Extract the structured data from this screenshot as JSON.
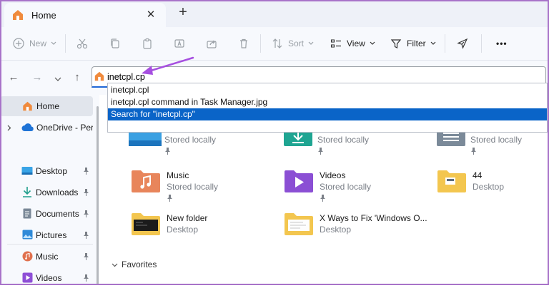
{
  "window": {
    "tab_title": "Home",
    "new_tab_symbol": "+",
    "close_symbol": "✕"
  },
  "toolbar": {
    "new_label": "New",
    "sort_label": "Sort",
    "view_label": "View",
    "filter_label": "Filter",
    "more_label": "•••"
  },
  "address_bar": {
    "value": "inetcpl.cp",
    "suggestions": [
      "inetcpl.cpl",
      "inetcpl.cpl command in Task Manager.jpg",
      "Search for \"inetcpl.cp\""
    ],
    "selected_index": 2
  },
  "sidebar": {
    "items": [
      {
        "label": "Home",
        "icon": "home-icon",
        "selected": true
      },
      {
        "label": "OneDrive - Perso",
        "icon": "cloud-icon"
      },
      {
        "label": "Desktop",
        "icon": "desktop-icon",
        "pinned": true
      },
      {
        "label": "Downloads",
        "icon": "download-icon",
        "pinned": true
      },
      {
        "label": "Documents",
        "icon": "document-icon",
        "pinned": true
      },
      {
        "label": "Pictures",
        "icon": "pictures-icon",
        "pinned": true
      },
      {
        "label": "Music",
        "icon": "music-icon",
        "pinned": true
      },
      {
        "label": "Videos",
        "icon": "videos-icon",
        "pinned": true
      }
    ]
  },
  "quick_access": {
    "items": [
      {
        "name": "",
        "sub": "Stored locally",
        "pinned": true,
        "icon": "desktop-folder-icon"
      },
      {
        "name": "",
        "sub": "Stored locally",
        "pinned": true,
        "icon": "downloads-folder-icon"
      },
      {
        "name": "",
        "sub": "Stored locally",
        "pinned": true,
        "icon": "documents-folder-icon"
      },
      {
        "name": "Music",
        "sub": "Stored locally",
        "pinned": true,
        "icon": "music-folder-icon"
      },
      {
        "name": "Videos",
        "sub": "Stored locally",
        "pinned": true,
        "icon": "videos-folder-icon"
      },
      {
        "name": "44",
        "sub": "Desktop",
        "pinned": false,
        "icon": "folder-icon"
      },
      {
        "name": "New folder",
        "sub": "Desktop",
        "pinned": false,
        "icon": "folder-icon"
      },
      {
        "name": "X Ways to Fix 'Windows O...",
        "sub": "Desktop",
        "pinned": false,
        "icon": "folder-icon"
      }
    ]
  },
  "favorites_label": "Favorites",
  "colors": {
    "accent": "#0a64c8",
    "arrow": "#a64fe0",
    "folder": "#f3c64f"
  }
}
